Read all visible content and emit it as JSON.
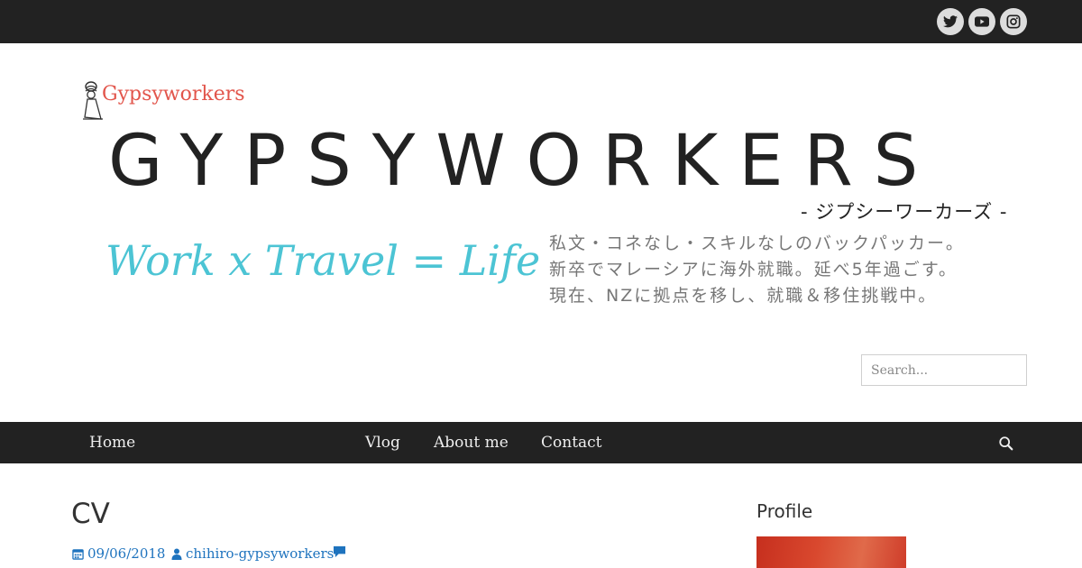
{
  "social": {
    "items": [
      {
        "name": "twitter",
        "icon": "twitter-icon"
      },
      {
        "name": "youtube",
        "icon": "youtube-icon"
      },
      {
        "name": "instagram",
        "icon": "instagram-icon"
      }
    ]
  },
  "header": {
    "small_logo_text": "Gypsyworkers",
    "title": "GYPSYWORKERS",
    "subtitle_jp": "- ジプシーワーカーズ -",
    "tagline": "Work x Travel = Life",
    "description_lines": [
      "私文・コネなし・スキルなしのバックパッカー。",
      "新卒でマレーシアに海外就職。延べ5年過ごす。",
      "現在、NZに拠点を移し、就職＆移住挑戦中。"
    ],
    "search_placeholder": "Search..."
  },
  "nav": {
    "items": [
      "Home",
      "Vlog",
      "About me",
      "Contact"
    ]
  },
  "post": {
    "title": "CV",
    "date": "09/06/2018",
    "author": "chihiro-gypsyworkers"
  },
  "sidebar": {
    "title": "Profile"
  },
  "colors": {
    "topbar": "#222222",
    "accent_link": "#1e73be",
    "tagline": "#4cc4d4",
    "small_logo": "#e2554b"
  }
}
